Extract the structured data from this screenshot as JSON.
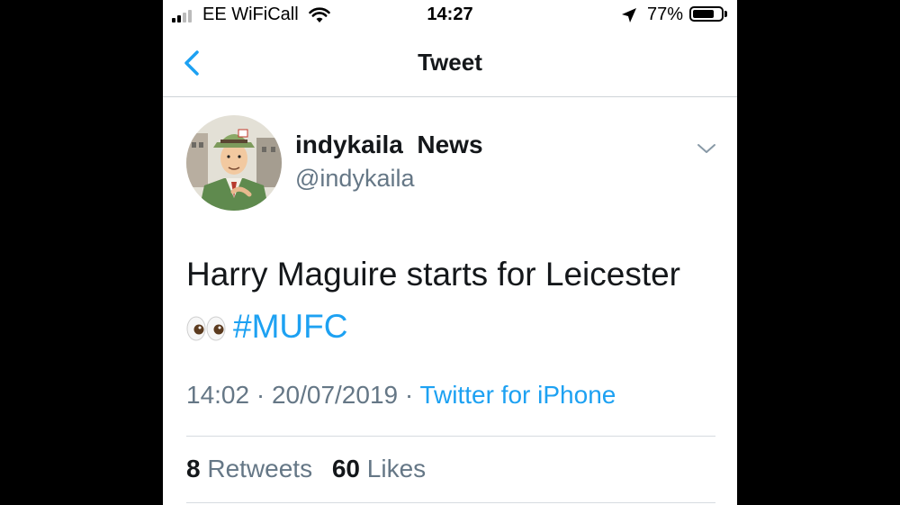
{
  "status_bar": {
    "carrier": "EE WiFiCall",
    "time": "14:27",
    "battery_percent": "77%",
    "battery_level": 0.77
  },
  "nav": {
    "title": "Tweet",
    "back_icon": "chevron-left-icon"
  },
  "tweet": {
    "display_name": "indykaila  News",
    "handle": "@indykaila",
    "text": "Harry Maguire starts for Leicester",
    "emoji": "eyes-emoji",
    "hashtag": "#MUFC",
    "timestamp": "14:02 · 20/07/2019 · ",
    "source": "Twitter for iPhone",
    "retweets_count": "8",
    "retweets_label": "Retweets",
    "likes_count": "60",
    "likes_label": "Likes"
  },
  "colors": {
    "accent": "#1da1f2",
    "secondary_text": "#657786",
    "primary_text": "#14171a",
    "divider": "#d6dbe0"
  }
}
